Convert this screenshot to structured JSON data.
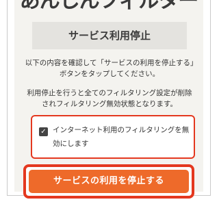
{
  "header": {
    "brand": "あんしんフィルター",
    "title": "サービス利用停止"
  },
  "main": {
    "description": "以下の内容を確認して「サービスの利用を停止する」ボタンをタップしてください。",
    "warning": "利用停止を行うと全てのフィルタリング設定が削除されフィルタリング無効状態となります。",
    "option": {
      "checked": true,
      "check_glyph": "✓",
      "label": "インターネット利用のフィルタリングを無効にします"
    },
    "action_button": "サービスの利用を停止する"
  },
  "colors": {
    "accent_red": "#e4381f",
    "button_orange": "#ee6a2a",
    "panel_bg": "#f4f3ef",
    "title_bg": "#e4e3df"
  }
}
